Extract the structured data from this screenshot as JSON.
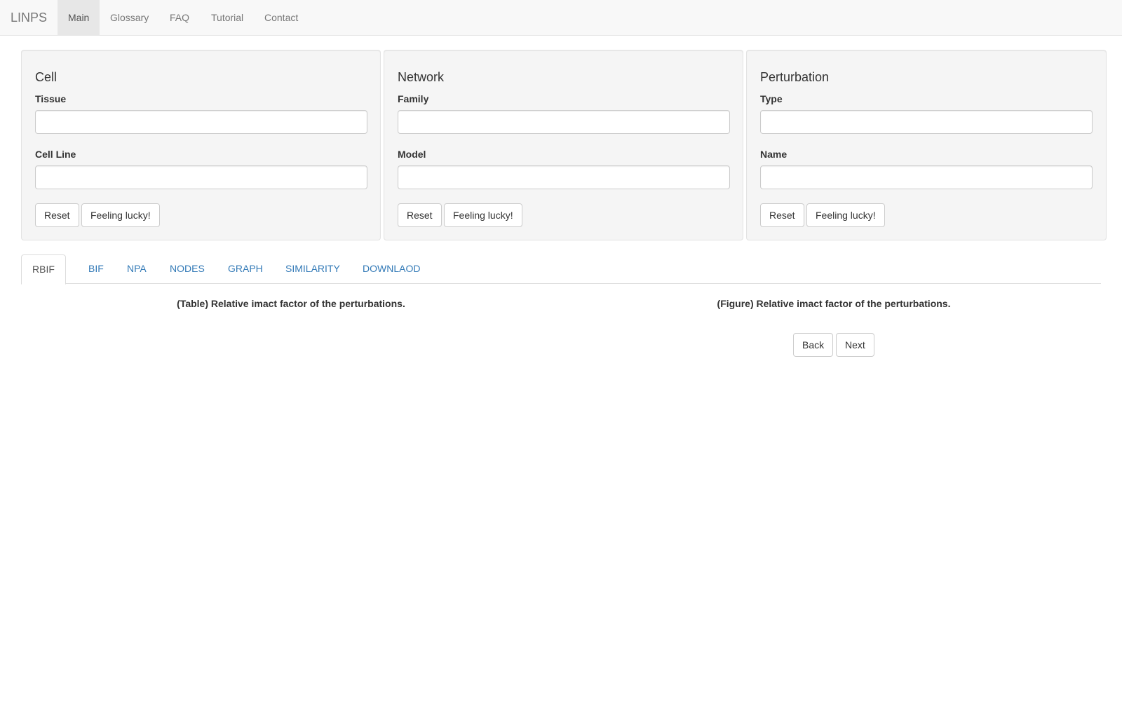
{
  "navbar": {
    "brand": "LINPS",
    "items": [
      {
        "label": "Main",
        "active": true
      },
      {
        "label": "Glossary"
      },
      {
        "label": "FAQ"
      },
      {
        "label": "Tutorial"
      },
      {
        "label": "Contact"
      }
    ]
  },
  "panels": [
    {
      "title": "Cell",
      "fields": [
        {
          "label": "Tissue",
          "value": "",
          "placeholder": ""
        },
        {
          "label": "Cell Line",
          "value": "",
          "placeholder": ""
        }
      ],
      "reset_label": "Reset",
      "lucky_label": "Feeling lucky!"
    },
    {
      "title": "Network",
      "fields": [
        {
          "label": "Family",
          "value": "",
          "placeholder": ""
        },
        {
          "label": "Model",
          "value": "",
          "placeholder": ""
        }
      ],
      "reset_label": "Reset",
      "lucky_label": "Feeling lucky!"
    },
    {
      "title": "Perturbation",
      "fields": [
        {
          "label": "Type",
          "value": "",
          "placeholder": ""
        },
        {
          "label": "Name",
          "value": "",
          "placeholder": ""
        }
      ],
      "reset_label": "Reset",
      "lucky_label": "Feeling lucky!"
    }
  ],
  "tabs": [
    {
      "label": "RBIF",
      "active": true
    },
    {
      "label": "BIF"
    },
    {
      "label": "NPA"
    },
    {
      "label": "NODES"
    },
    {
      "label": "GRAPH"
    },
    {
      "label": "SIMILARITY"
    },
    {
      "label": "DOWNLAOD"
    }
  ],
  "content": {
    "table_caption": "(Table) Relative imact factor of the perturbations.",
    "figure_caption": "(Figure) Relative imact factor of the perturbations.",
    "back_label": "Back",
    "next_label": "Next"
  },
  "colors": {
    "link": "#337ab7",
    "navbar_bg": "#f8f8f8",
    "panel_bg": "#f5f5f5"
  }
}
